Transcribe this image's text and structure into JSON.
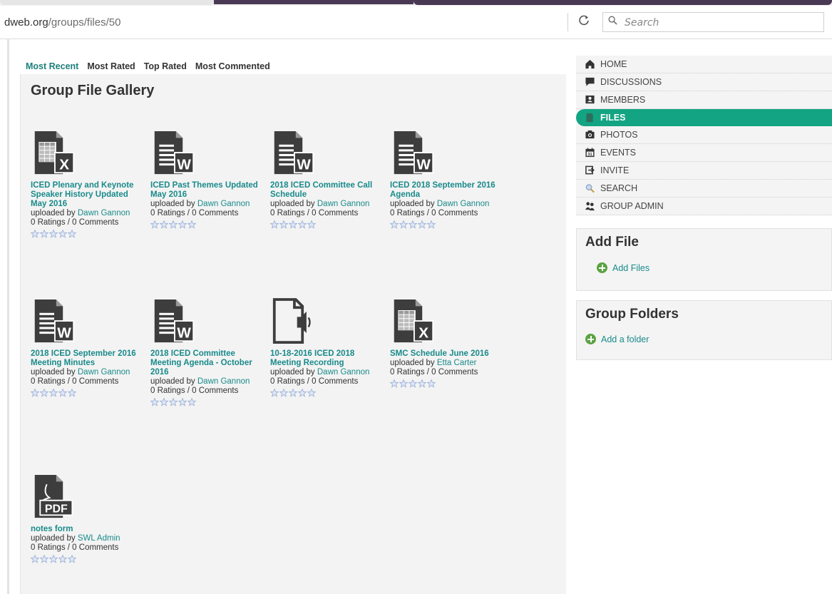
{
  "browser": {
    "url_host": "dweb.org",
    "url_path": "/groups/files/50",
    "search_placeholder": "Search",
    "reload_glyph": "C"
  },
  "sort_tabs": [
    "Most Recent",
    "Most Rated",
    "Top Rated",
    "Most Commented"
  ],
  "gallery": {
    "title": "Group File Gallery",
    "files": [
      {
        "title": "ICED Plenary and Keynote Speaker History Updated May 2016",
        "uploaded_by_text": "uploaded by",
        "uploader": "Dawn Gannon",
        "counts": "0 Ratings / 0 Comments",
        "icon": "excel-file-icon"
      },
      {
        "title": "ICED Past Themes Updated May 2016",
        "uploaded_by_text": "uploaded by",
        "uploader": "Dawn Gannon",
        "counts": "0 Ratings / 0 Comments",
        "icon": "word-file-icon"
      },
      {
        "title": "2018 ICED Committee Call Schedule",
        "uploaded_by_text": "uploaded by",
        "uploader": "Dawn Gannon",
        "counts": "0 Ratings / 0 Comments",
        "icon": "word-file-icon"
      },
      {
        "title": "ICED 2018 September 2016 Agenda",
        "uploaded_by_text": "uploaded by",
        "uploader": "Dawn Gannon",
        "counts": "0 Ratings / 0 Comments",
        "icon": "word-file-icon"
      },
      {
        "title": "2018 ICED September 2016 Meeting Minutes",
        "uploaded_by_text": "uploaded by",
        "uploader": "Dawn Gannon",
        "counts": "0 Ratings / 0 Comments",
        "icon": "word-file-icon"
      },
      {
        "title": "2018 ICED Committee Meeting Agenda - October 2016",
        "uploaded_by_text": "uploaded by",
        "uploader": "Dawn Gannon",
        "counts": "0 Ratings / 0 Comments",
        "icon": "word-file-icon"
      },
      {
        "title": "10-18-2016 ICED 2018 Meeting Recording",
        "uploaded_by_text": "uploaded by",
        "uploader": "Dawn Gannon",
        "counts": "0 Ratings / 0 Comments",
        "icon": "audio-file-icon"
      },
      {
        "title": "SMC Schedule June 2016",
        "uploaded_by_text": "uploaded by",
        "uploader": "Etta Carter",
        "counts": "0 Ratings / 0 Comments",
        "icon": "excel-file-icon"
      },
      {
        "title": "notes form",
        "uploaded_by_text": "uploaded by",
        "uploader": "SWL Admin",
        "counts": "0 Ratings / 0 Comments",
        "icon": "pdf-file-icon"
      }
    ],
    "stars_per_file": 5
  },
  "sidebar": {
    "nav": [
      {
        "label": "HOME",
        "icon": "home-icon"
      },
      {
        "label": "DISCUSSIONS",
        "icon": "speech-bubble-icon"
      },
      {
        "label": "MEMBERS",
        "icon": "contact-card-icon"
      },
      {
        "label": "FILES",
        "icon": "file-icon",
        "active": true
      },
      {
        "label": "PHOTOS",
        "icon": "camera-icon"
      },
      {
        "label": "EVENTS",
        "icon": "calendar-icon"
      },
      {
        "label": "INVITE",
        "icon": "invite-arrow-icon"
      },
      {
        "label": "SEARCH",
        "icon": "magnifier-icon"
      },
      {
        "label": "GROUP ADMIN",
        "icon": "admin-people-icon"
      }
    ],
    "add_file": {
      "title": "Add File",
      "link": "Add Files"
    },
    "group_folders": {
      "title": "Group Folders",
      "link": "Add a folder"
    }
  },
  "colors": {
    "accent_teal": "#1a8a8a",
    "active_nav_green": "#13a483",
    "add_plus_green": "#5aa340",
    "icon_dark": "#3d3d3d",
    "star_blue": "#9fb3d8"
  }
}
